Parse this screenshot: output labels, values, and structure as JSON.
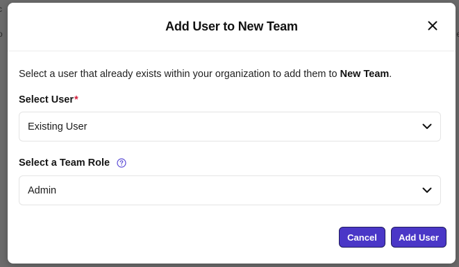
{
  "modal": {
    "title": "Add User to New Team",
    "intro_prefix": "Select a user that already exists within your organization to add them to ",
    "team_name": "New Team",
    "intro_suffix": ".",
    "select_user": {
      "label": "Select User",
      "required_mark": "*",
      "value": "Existing User"
    },
    "team_role": {
      "label": "Select a Team Role",
      "value": "Admin"
    },
    "buttons": {
      "cancel": "Cancel",
      "add_user": "Add User"
    }
  },
  "icons": {
    "close": "close-icon",
    "chevron": "chevron-down-icon",
    "help": "question-circle-icon"
  },
  "colors": {
    "primary_button": "#4a37c7",
    "required": "#d21f3c",
    "help_icon": "#5b4bd6",
    "overlay": "#6b6b6b"
  }
}
